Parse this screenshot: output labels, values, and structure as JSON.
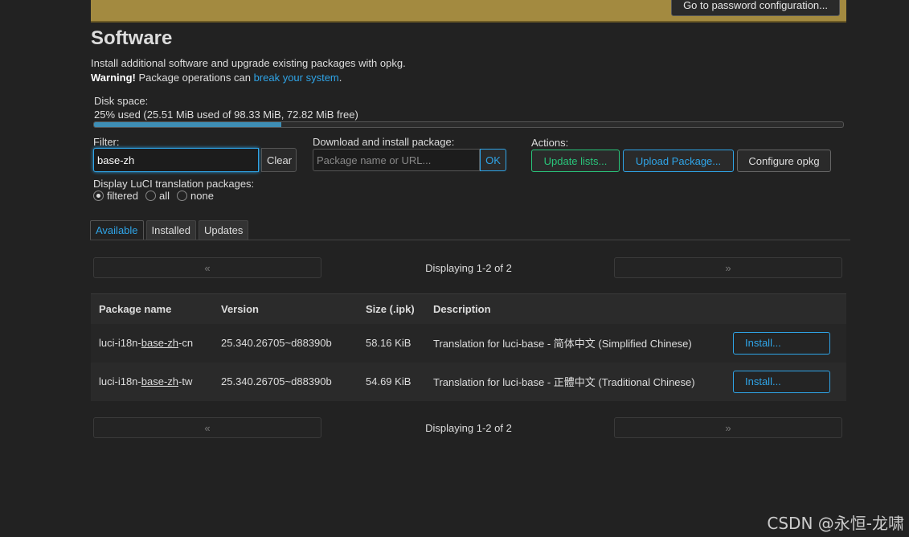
{
  "banner": {
    "button_label": "Go to password configuration..."
  },
  "page": {
    "title": "Software",
    "description": "Install additional software and upgrade existing packages with opkg.",
    "warning_bold": "Warning!",
    "warning_text": " Package operations can ",
    "warning_link": "break your system",
    "warning_end": "."
  },
  "disk": {
    "label": "Disk space:",
    "text": "25% used (25.51 MiB used of 98.33 MiB, 72.82 MiB free)",
    "used_percent": 25
  },
  "filter": {
    "label": "Filter:",
    "value": "base-zh",
    "clear_label": "Clear"
  },
  "download": {
    "label": "Download and install package:",
    "placeholder": "Package name or URL...",
    "ok_label": "OK"
  },
  "actions": {
    "label": "Actions:",
    "update_lists": "Update lists...",
    "upload_package": "Upload Package...",
    "configure_opkg": "Configure opkg"
  },
  "translation": {
    "label": "Display LuCI translation packages:",
    "options": [
      "filtered",
      "all",
      "none"
    ],
    "selected": "filtered"
  },
  "tabs": [
    "Available",
    "Installed",
    "Updates"
  ],
  "active_tab": "Available",
  "pager": {
    "prev": "«",
    "next": "»",
    "text": "Displaying 1-2 of 2"
  },
  "table": {
    "headers": [
      "Package name",
      "Version",
      "Size (.ipk)",
      "Description"
    ],
    "rows": [
      {
        "name_pre": "luci-i18n-",
        "name_hl": "base-zh",
        "name_post": "-cn",
        "version": "25.340.26705~d88390b",
        "size": "58.16 KiB",
        "description": "Translation for luci-base - 简体中文 (Simplified Chinese)",
        "action": "Install..."
      },
      {
        "name_pre": "luci-i18n-",
        "name_hl": "base-zh",
        "name_post": "-tw",
        "version": "25.340.26705~d88390b",
        "size": "54.69 KiB",
        "description": "Translation for luci-base - 正體中文 (Traditional Chinese)",
        "action": "Install..."
      }
    ]
  },
  "watermark": "CSDN @永恒-龙啸"
}
